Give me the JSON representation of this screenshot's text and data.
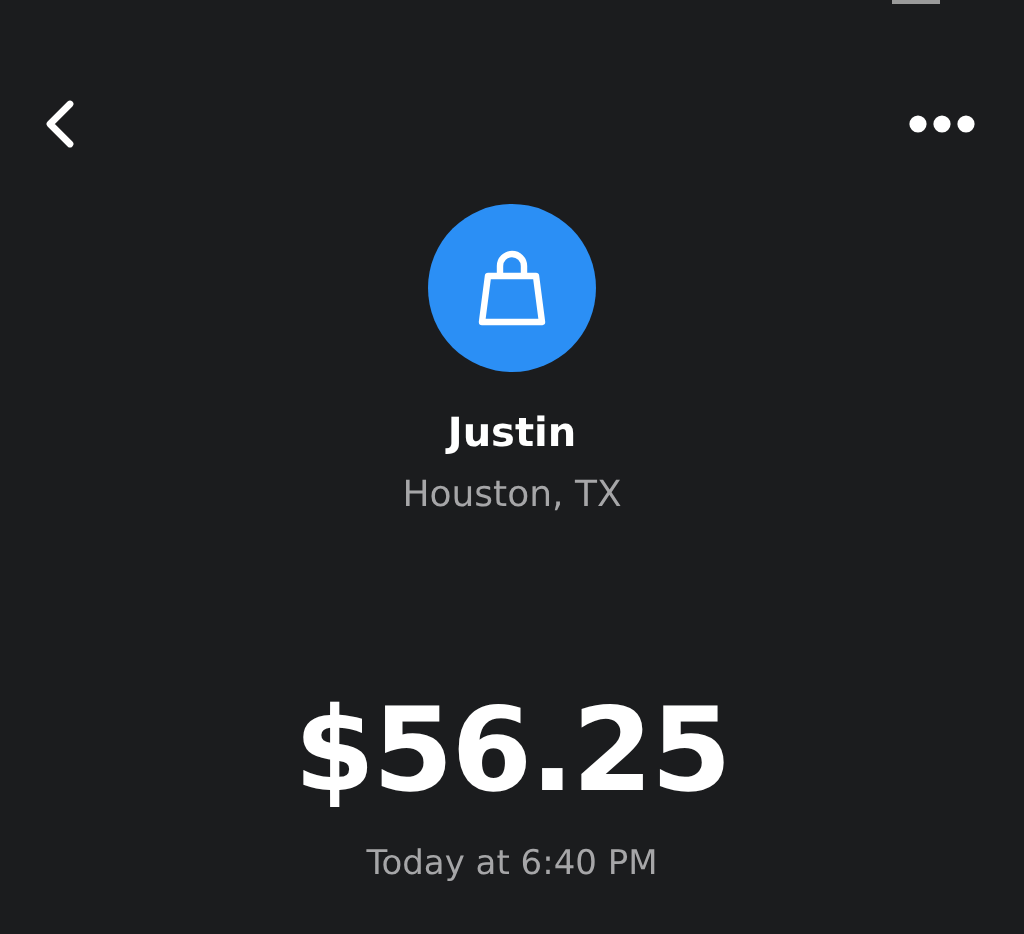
{
  "merchant": {
    "name": "Justin",
    "location": "Houston, TX"
  },
  "payment": {
    "amount": "$56.25",
    "time": "Today at 6:40 PM"
  }
}
